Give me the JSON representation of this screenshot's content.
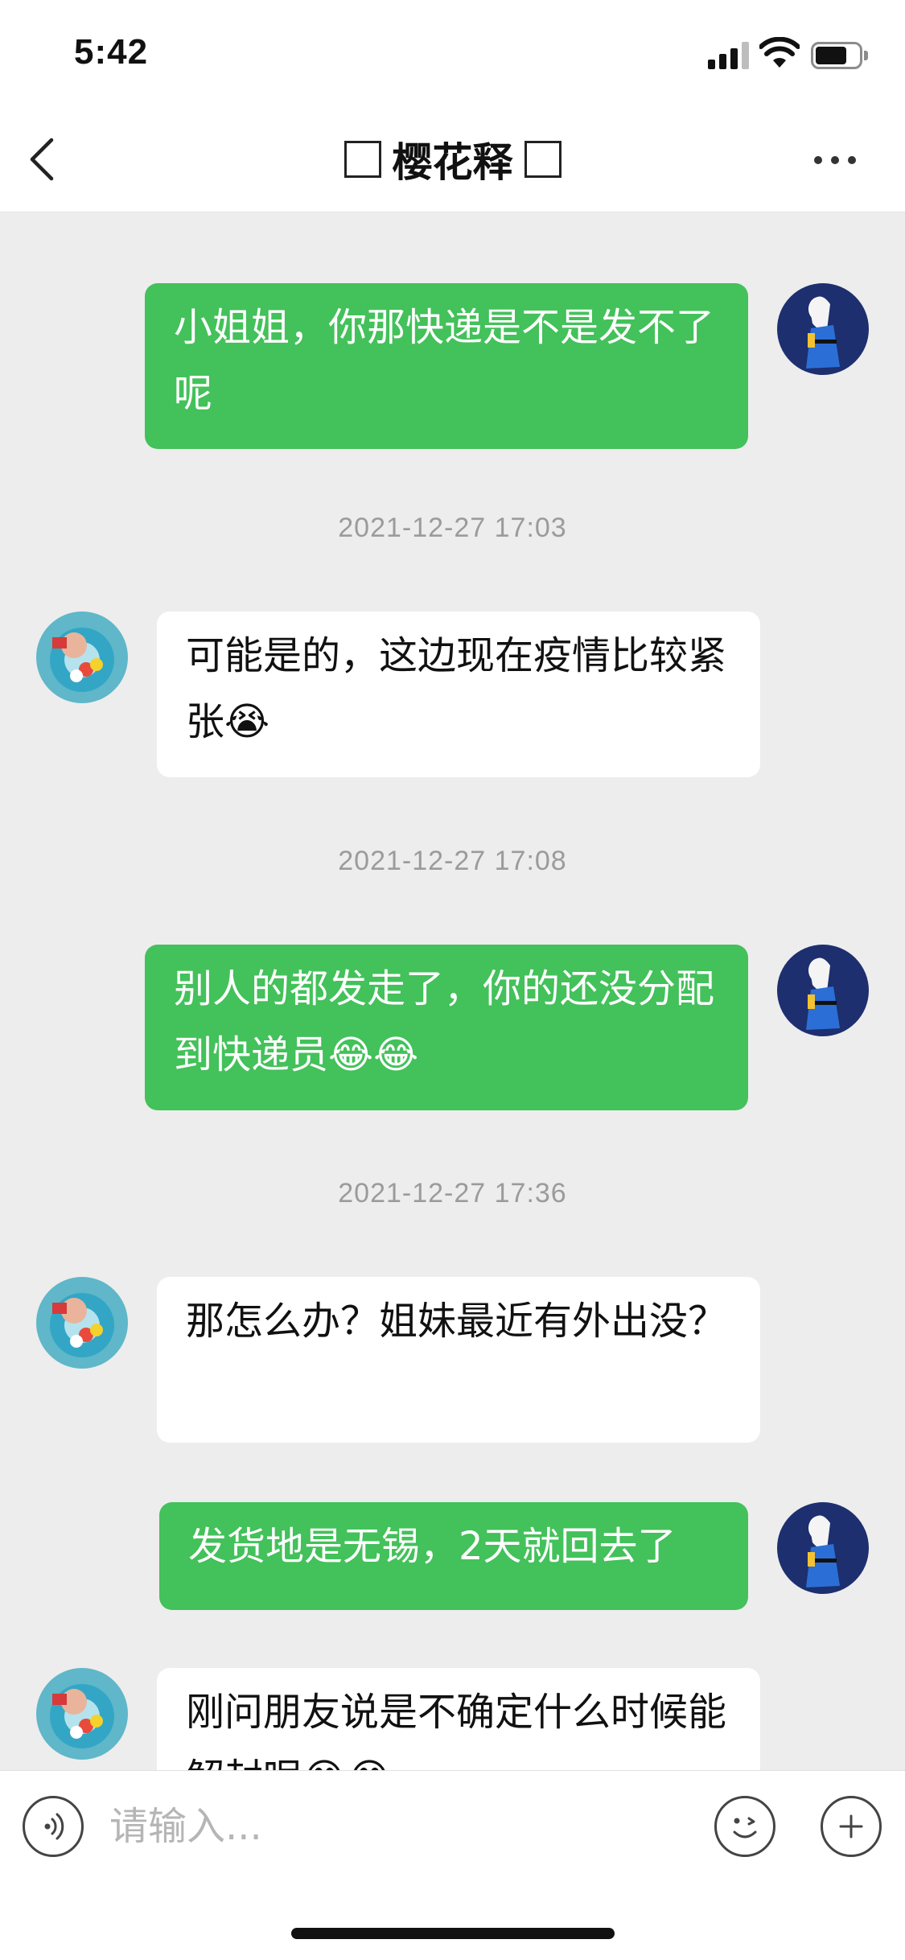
{
  "status_bar": {
    "time": "5:42"
  },
  "nav": {
    "title": "樱花释",
    "back_icon": "chevron-left-icon",
    "more_icon": "ellipsis-icon"
  },
  "messages": [
    {
      "sender": "me",
      "text": "小姐姐，你那快递是不是发不了呢"
    },
    {
      "type": "timestamp",
      "text": "2021-12-27 17:03"
    },
    {
      "sender": "them",
      "text": "可能是的，这边现在疫情比较紧张😭"
    },
    {
      "type": "timestamp",
      "text": "2021-12-27 17:08"
    },
    {
      "sender": "me",
      "text": "别人的都发走了，你的还没分配到快递员😂😂"
    },
    {
      "type": "timestamp",
      "text": "2021-12-27 17:36"
    },
    {
      "sender": "them",
      "text": "那怎么办？姐妹最近有外出没？"
    },
    {
      "sender": "me",
      "text": "发货地是无锡，2天就回去了"
    },
    {
      "sender": "them",
      "text": "刚问朋友说是不确定什么时候能解封呢😂😂"
    }
  ],
  "input_bar": {
    "placeholder": "请输入...",
    "voice_icon": "voice-icon",
    "emoji_icon": "emoji-icon",
    "plus_icon": "plus-icon"
  },
  "colors": {
    "my_bubble": "#43c15a",
    "their_bubble": "#ffffff",
    "chat_background": "#ededed",
    "timestamp": "#9b9b9b"
  }
}
